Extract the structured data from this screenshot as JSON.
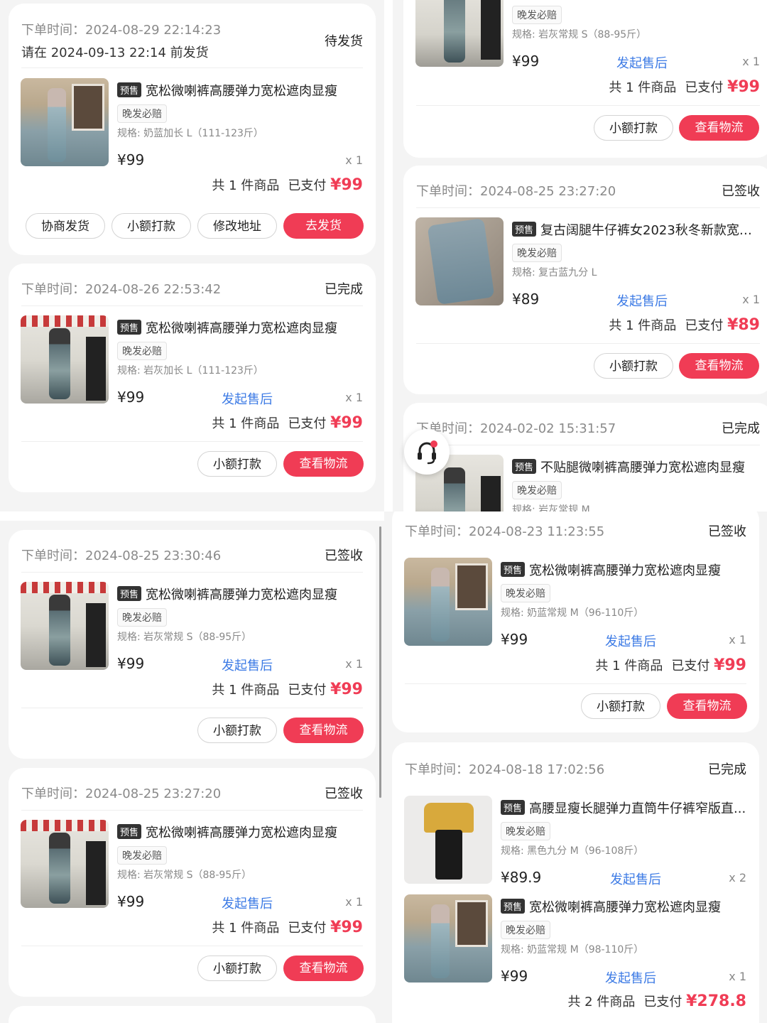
{
  "labels": {
    "order_time": "下单时间：",
    "pre": "预售",
    "tag": "晚发必赔",
    "after_sale": "发起售后",
    "small_pay": "小额打款",
    "logistics": "查看物流",
    "negotiate": "协商发货",
    "modify_addr": "修改地址",
    "go_ship": "去发货",
    "paid_label": "已支付"
  },
  "p1c1": {
    "time": "2024-08-29 22:14:23",
    "deadline": "请在 2024-09-13 22:14 前发货",
    "status": "待发货",
    "title": "宽松微喇裤高腰弹力宽松遮肉显瘦",
    "spec": "规格: 奶蓝加长 L（111-123斤）",
    "price": "¥99",
    "qty": "x 1",
    "count": "共 1 件商品",
    "paid": "¥99"
  },
  "p1c2": {
    "time": "2024-08-26 22:53:42",
    "status": "已完成",
    "title": "宽松微喇裤高腰弹力宽松遮肉显瘦",
    "spec": "规格: 岩灰加长 L（111-123斤）",
    "price": "¥99",
    "qty": "x 1",
    "count": "共 1 件商品",
    "paid": "¥99"
  },
  "p2c1": {
    "spec": "规格: 岩灰常规 S（88-95斤）",
    "price": "¥99",
    "qty": "x 1",
    "count": "共 1 件商品",
    "paid": "¥99"
  },
  "p2c2": {
    "time": "2024-08-25 23:27:20",
    "status": "已签收",
    "title": "复古阔腿牛仔裤女2023秋冬新款宽松...",
    "spec": "规格: 复古蓝九分 L",
    "price": "¥89",
    "qty": "x 1",
    "count": "共 1 件商品",
    "paid": "¥89"
  },
  "p2c3": {
    "time": "2024-02-02 15:31:57",
    "status": "已完成",
    "title": "不贴腿微喇裤高腰弹力宽松遮肉显瘦",
    "spec": "规格: 岩灰常规 M"
  },
  "p3c1": {
    "time": "2024-08-25 23:30:46",
    "status": "已签收",
    "title": "宽松微喇裤高腰弹力宽松遮肉显瘦",
    "spec": "规格: 岩灰常规 S（88-95斤）",
    "price": "¥99",
    "qty": "x 1",
    "count": "共 1 件商品",
    "paid": "¥99"
  },
  "p3c2": {
    "time": "2024-08-25 23:27:20",
    "status": "已签收",
    "title": "宽松微喇裤高腰弹力宽松遮肉显瘦",
    "spec": "规格: 岩灰常规 S（88-95斤）",
    "price": "¥99",
    "qty": "x 1",
    "count": "共 1 件商品",
    "paid": "¥99"
  },
  "p4c1": {
    "time": "2024-08-23 11:23:55",
    "status": "已签收",
    "title": "宽松微喇裤高腰弹力宽松遮肉显瘦",
    "spec": "规格: 奶蓝常规 M（96-110斤）",
    "price": "¥99",
    "qty": "x 1",
    "count": "共 1 件商品",
    "paid": "¥99"
  },
  "p4c2": {
    "time": "2024-08-18 17:02:56",
    "status": "已完成",
    "item1": {
      "title": "高腰显瘦长腿弹力直筒牛仔裤窄版直...",
      "spec": "规格: 黑色九分 M（96-108斤）",
      "price": "¥89.9",
      "qty": "x 2"
    },
    "item2": {
      "title": "宽松微喇裤高腰弹力宽松遮肉显瘦",
      "spec": "规格: 奶蓝常规 M（98-110斤）",
      "price": "¥99",
      "qty": "x 1"
    },
    "count": "共 2 件商品",
    "paid": "¥278.8"
  },
  "colors": {
    "accent_red": "#f03c55",
    "link_blue": "#3d7be5",
    "page_bg": "#f4f4f4",
    "card_bg": "#ffffff"
  }
}
